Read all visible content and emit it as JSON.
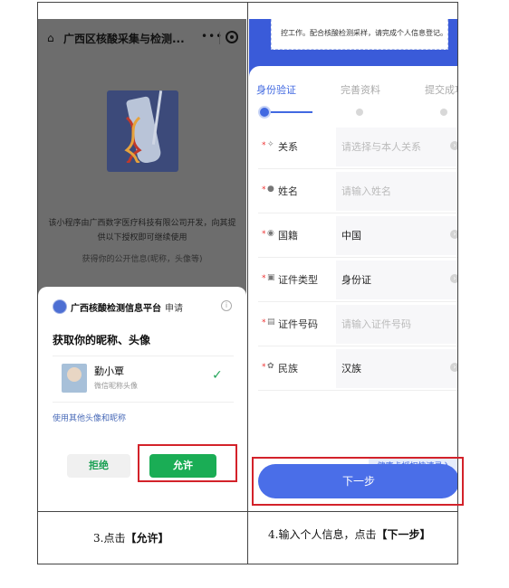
{
  "left": {
    "title": "广西区核酸采集与检测...",
    "menu_dots": "•••",
    "intro_line1": "该小程序由广西数字医疗科技有限公司开发，向其提",
    "intro_line2": "供以下授权即可继续使用",
    "intro_scope": "获得你的公开信息(昵称，头像等)",
    "app_name": "广西核酸检测信息平台",
    "apply": "申请",
    "request": "获取你的昵称、头像",
    "user_name": "勤小覃",
    "user_sub": "微信昵称头像",
    "other_avatar": "使用其他头像和昵称",
    "reject_label": "拒绝",
    "allow_label": "允许",
    "check_icon": "check-icon",
    "accent_color": "#1aad55"
  },
  "right": {
    "notice": "控工作。配合核酸检测采样，请完成个人信息登记。",
    "steps": [
      {
        "label": "身份验证",
        "state": "active"
      },
      {
        "label": "完善资料",
        "state": "idle"
      },
      {
        "label": "提交成功",
        "state": "idle"
      }
    ],
    "fields": [
      {
        "icon": "relation-icon",
        "glyph": "✧",
        "label": "关系",
        "value": "请选择与本人关系",
        "placeholder": true,
        "arrow": true
      },
      {
        "icon": "person-icon",
        "glyph": "●",
        "label": "姓名",
        "value": "请输入姓名",
        "placeholder": true,
        "arrow": false
      },
      {
        "icon": "globe-icon",
        "glyph": "◉",
        "label": "国籍",
        "value": "中国",
        "placeholder": false,
        "arrow": true
      },
      {
        "icon": "id-card-icon",
        "glyph": "▣",
        "label": "证件类型",
        "value": "身份证",
        "placeholder": false,
        "arrow": true
      },
      {
        "icon": "id-number-icon",
        "glyph": "▤",
        "label": "证件号码",
        "value": "请输入证件号码",
        "placeholder": true,
        "arrow": false
      },
      {
        "icon": "ethnicity-icon",
        "glyph": "✿",
        "label": "民族",
        "value": "汉族",
        "placeholder": false,
        "arrow": true
      }
    ],
    "health_card": "健康卡授权快速录入",
    "next_label": "下一步",
    "accent_color": "#4169e1"
  },
  "captions": {
    "left_prefix": "3.点击",
    "left_bold": "【允许】",
    "right_prefix": "4.输入个人信息，点击",
    "right_bold": "【下一步】"
  }
}
